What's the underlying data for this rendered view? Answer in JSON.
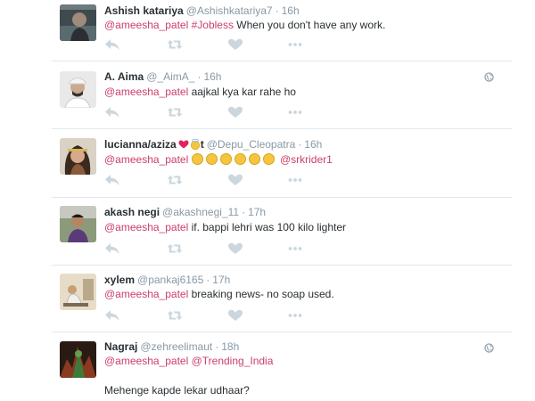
{
  "colors": {
    "accent": "#cc3d6b",
    "meta": "#8899a6",
    "text": "#292f33",
    "divider": "#e1e8ed",
    "icon": "#ccd6dd"
  },
  "tweets": [
    {
      "name": "Ashish katariya",
      "handle": "@Ashishkatariya7",
      "time": "16h",
      "mention": "@ameesha_patel",
      "hashtag": "#Jobless",
      "text": " When you don't have any work."
    },
    {
      "name": "A. Aima",
      "handle": "@_AimA_",
      "time": "16h",
      "mention": "@ameesha_patel",
      "text": " aajkal kya kar rahe ho"
    },
    {
      "name": "lucianna/aziza",
      "name_suffix": "t",
      "handle": "@Depu_Cleopatra",
      "time": "16h",
      "mention": "@ameesha_patel",
      "mention2": "@srkrider1"
    },
    {
      "name": "akash negi",
      "handle": "@akashnegi_11",
      "time": "17h",
      "mention": "@ameesha_patel",
      "text": " if. bappi lehri was 100 kilo lighter"
    },
    {
      "name": "xylem",
      "handle": "@pankaj6165",
      "time": "17h",
      "mention": "@ameesha_patel",
      "text": " breaking news- no soap used."
    },
    {
      "name": "Nagraj",
      "handle": "@zehreelimaut",
      "time": "18h",
      "mention": "@ameesha_patel",
      "mention2": "@Trending_India",
      "text2": "Mehenge kapde lekar udhaar?"
    }
  ],
  "dot": "·",
  "icons": [
    "reply-icon",
    "retweet-icon",
    "like-icon",
    "more-icon",
    "globe-icon"
  ]
}
